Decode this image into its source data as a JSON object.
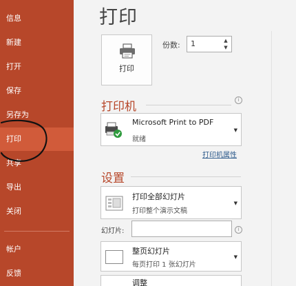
{
  "sidebar": {
    "items": [
      {
        "label": "信息"
      },
      {
        "label": "新建"
      },
      {
        "label": "打开"
      },
      {
        "label": "保存"
      },
      {
        "label": "另存为"
      },
      {
        "label": "打印"
      },
      {
        "label": "共享"
      },
      {
        "label": "导出"
      },
      {
        "label": "关闭"
      },
      {
        "label": "帐户"
      },
      {
        "label": "反馈"
      }
    ],
    "selected": "打印"
  },
  "main": {
    "title": "打印",
    "print_button": {
      "label": "打印"
    },
    "copies": {
      "label": "份数:",
      "value": "1"
    },
    "printer": {
      "section_title": "打印机",
      "name": "Microsoft Print to PDF",
      "status": "就绪",
      "properties_link": "打印机属性"
    },
    "settings": {
      "section_title": "设置",
      "print_range": {
        "title": "打印全部幻灯片",
        "subtitle": "打印整个演示文稿"
      },
      "slides": {
        "label": "幻灯片:",
        "value": ""
      },
      "layout": {
        "title": "整页幻灯片",
        "subtitle": "每页打印 1 张幻灯片"
      },
      "collation": {
        "title": "调整"
      }
    }
  },
  "colors": {
    "accent": "#b7472a",
    "sidebar_selected": "#d15b3a",
    "link": "#2e5b8c"
  },
  "icons": {
    "printer": "printer-icon",
    "pdf_printer": "pdf-printer-icon",
    "info": "info-icon",
    "slides": "all-slides-icon",
    "layout": "full-page-slide-icon"
  }
}
